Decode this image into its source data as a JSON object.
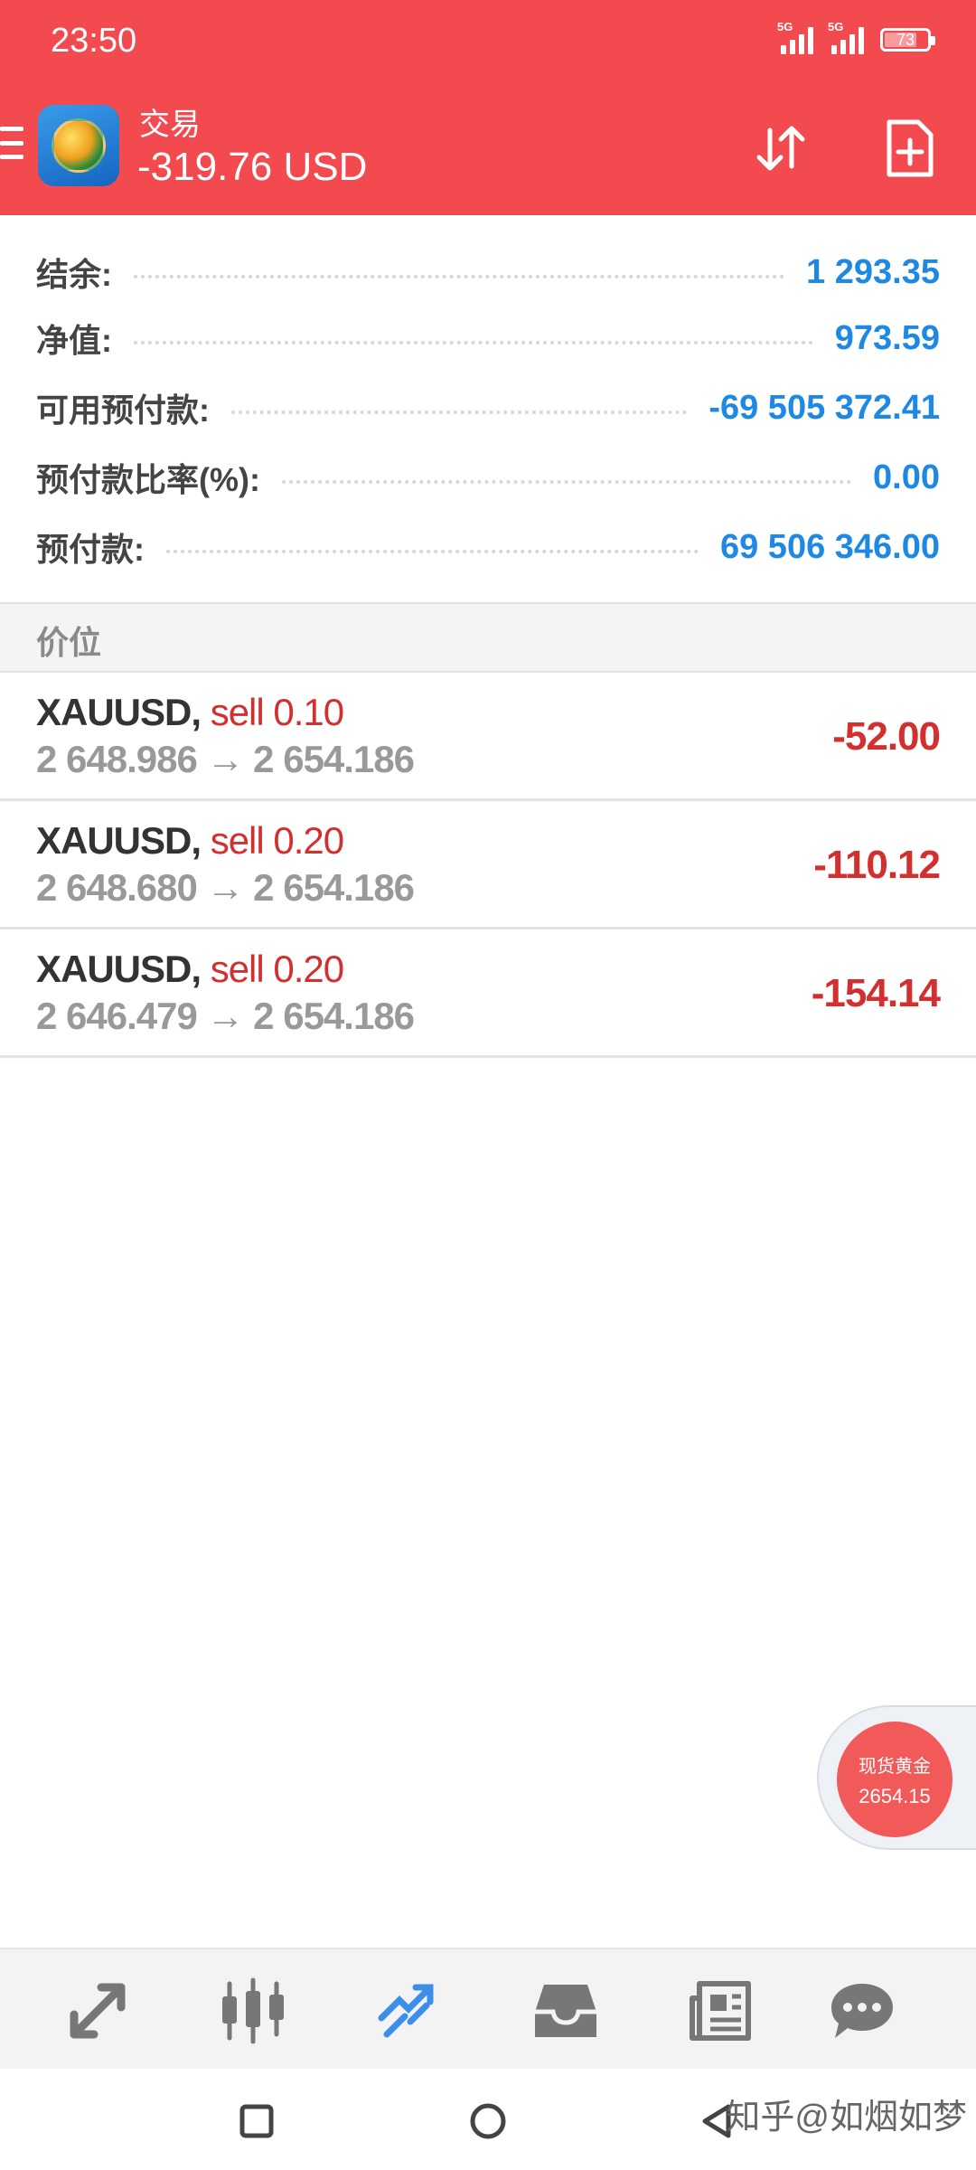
{
  "status_bar": {
    "time": "23:50",
    "signal1_tag": "5G",
    "signal2_tag": "5G",
    "battery": "73"
  },
  "header": {
    "title": "交易",
    "balance": "-319.76 USD"
  },
  "summary": {
    "balance_label": "结余:",
    "balance_value": "1 293.35",
    "equity_label": "净值:",
    "equity_value": "973.59",
    "free_margin_label": "可用预付款:",
    "free_margin_value": "-69 505 372.41",
    "margin_level_label": "预付款比率(%):",
    "margin_level_value": "0.00",
    "margin_label": "预付款:",
    "margin_value": "69 506 346.00"
  },
  "section": {
    "label": "价位"
  },
  "positions": [
    {
      "symbol": "XAUUSD,",
      "side": "sell 0.10",
      "prices": "2 648.986 → 2 654.186",
      "profit": "-52.00"
    },
    {
      "symbol": "XAUUSD,",
      "side": "sell 0.20",
      "prices": "2 648.680 → 2 654.186",
      "profit": "-110.12"
    },
    {
      "symbol": "XAUUSD,",
      "side": "sell 0.20",
      "prices": "2 646.479 → 2 654.186",
      "profit": "-154.14"
    }
  ],
  "widget": {
    "title": "现货黄金",
    "price": "2654.15"
  },
  "bottom_nav": [
    "quotes-icon",
    "chart-icon",
    "trade-icon",
    "history-icon",
    "news-icon",
    "chat-icon"
  ],
  "colors": {
    "header": "#f24a4f",
    "value_blue": "#1e88e5",
    "loss_red": "#d32f2f",
    "active_nav": "#3d8ee8"
  },
  "watermark": "知乎@如烟如梦"
}
